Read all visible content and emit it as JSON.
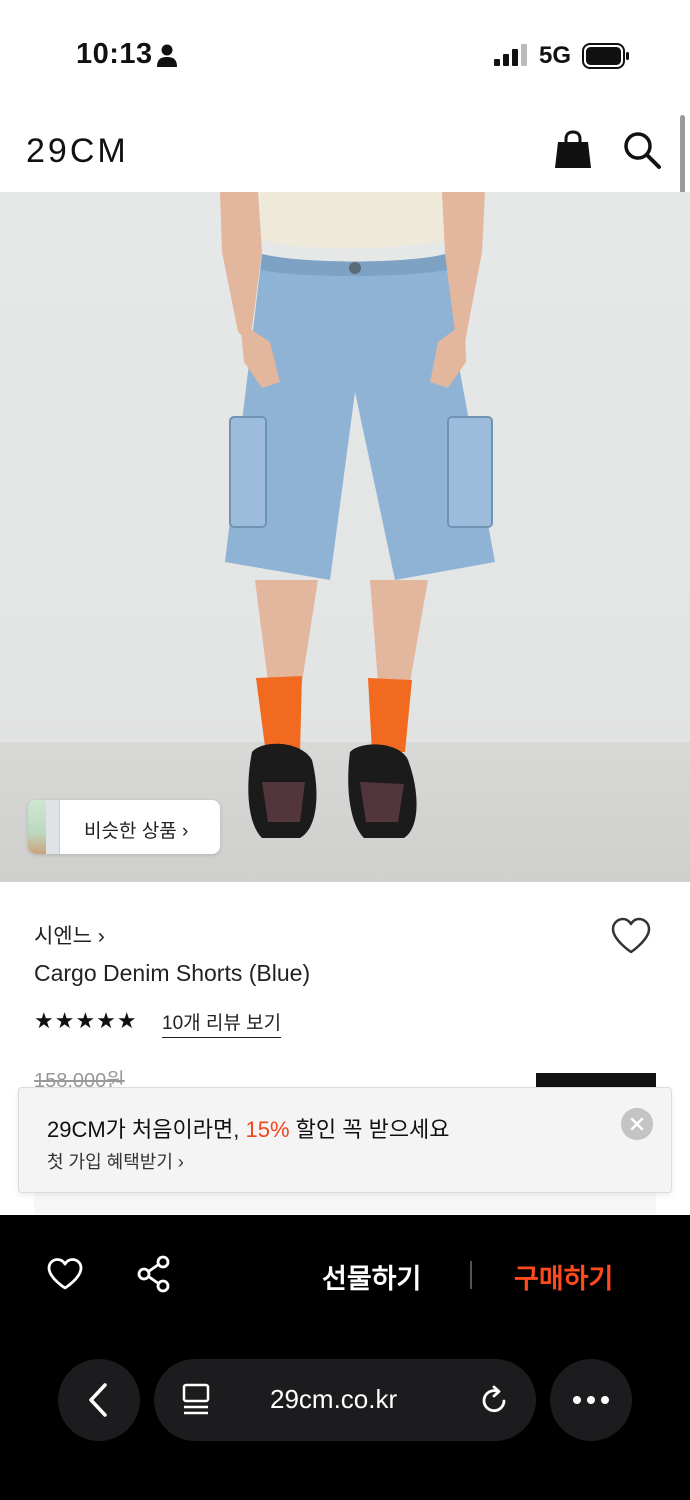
{
  "status_bar": {
    "time": "10:13",
    "network": "5G"
  },
  "header": {
    "logo": "29CM"
  },
  "gallery": {
    "similar_label": "비슷한 상품 ›"
  },
  "product": {
    "brand": "시엔느 ›",
    "name": "Cargo Denim Shorts (Blue)",
    "rating_stars": "★★★★★",
    "rating": 4.5,
    "review_link": "10개 리뷰 보기",
    "original_price": "158,000원"
  },
  "banner": {
    "main_prefix": "29CM가 처음이라면, ",
    "main_accent": "15%",
    "main_suffix": " 할인 꼭 받으세요",
    "link": "첫 가입 혜택받기 ›"
  },
  "action_bar": {
    "gift_label": "선물하기",
    "buy_label": "구매하기"
  },
  "browser": {
    "url": "29cm.co.kr"
  },
  "colors": {
    "accent": "#ff4a1c",
    "background": "#ffffff",
    "bar": "#000000"
  }
}
